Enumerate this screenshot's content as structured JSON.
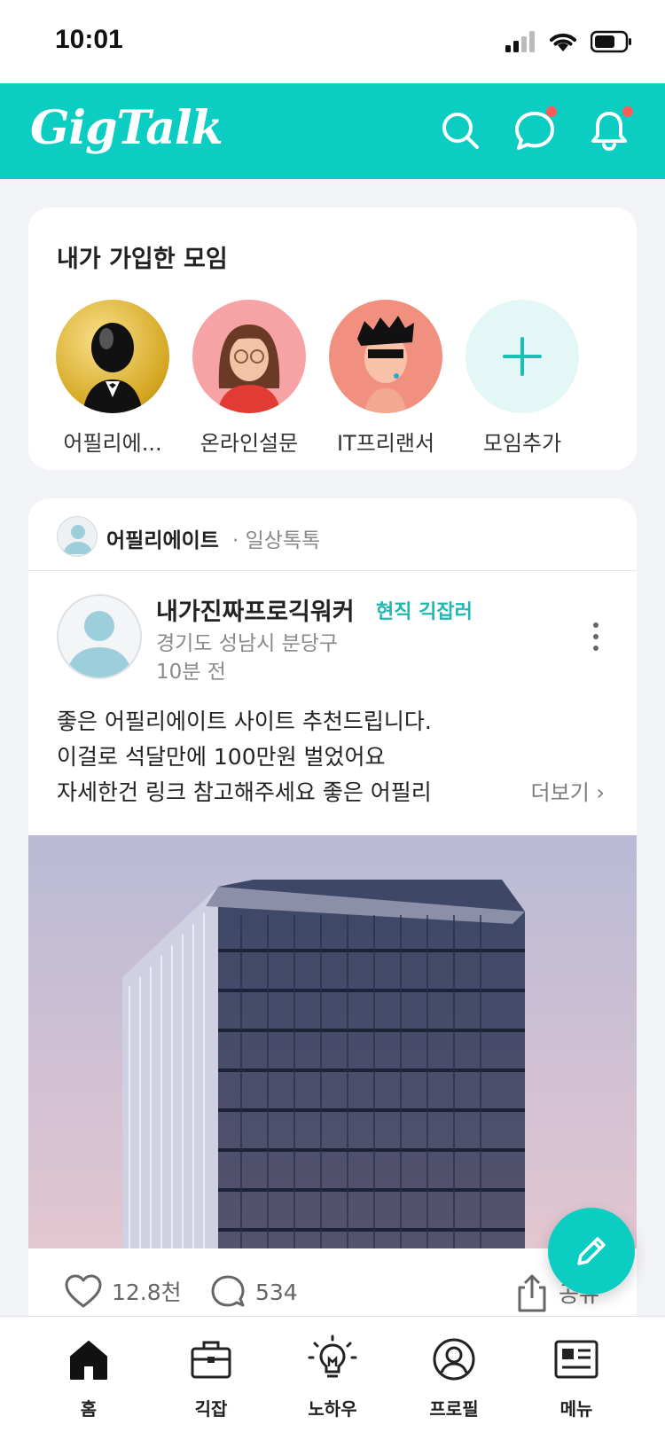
{
  "status_bar": {
    "time": "10:01"
  },
  "header": {
    "logo": "GigTalk"
  },
  "groups_section": {
    "title": "내가 가입한 모임",
    "groups": [
      {
        "label": "어필리에..."
      },
      {
        "label": "온라인설문"
      },
      {
        "label": "IT프리랜서"
      },
      {
        "label": "모임추가"
      }
    ]
  },
  "post": {
    "group_name": "어필리에이트",
    "group_sub": "· 일상톡톡",
    "author": {
      "name": "내가진짜프로긱워커",
      "badge": "현직 긱잡러",
      "location": "경기도 성남시 분당구",
      "time": "10분 전"
    },
    "text_lines": [
      "좋은 어필리에이트 사이트 추천드립니다.",
      "이걸로 석달만에 100만원 벌었어요",
      "자세한건 링크 참고해주세요 좋은 어필리"
    ],
    "read_more": "더보기 ›",
    "likes": "12.8천",
    "comments": "534",
    "share": "공유"
  },
  "bottom_nav": [
    {
      "label": "홈"
    },
    {
      "label": "긱잡"
    },
    {
      "label": "노하우"
    },
    {
      "label": "프로필"
    },
    {
      "label": "메뉴"
    }
  ],
  "colors": {
    "brand": "#0bcdc2",
    "badge": "#20b8b0",
    "notification_dot": "#ff5a5a"
  },
  "icons": [
    "search-icon",
    "chat-icon",
    "bell-icon",
    "more-icon",
    "heart-icon",
    "comment-icon",
    "share-icon",
    "pencil-icon",
    "home-icon",
    "briefcase-icon",
    "lightbulb-icon",
    "profile-icon",
    "menu-icon"
  ]
}
